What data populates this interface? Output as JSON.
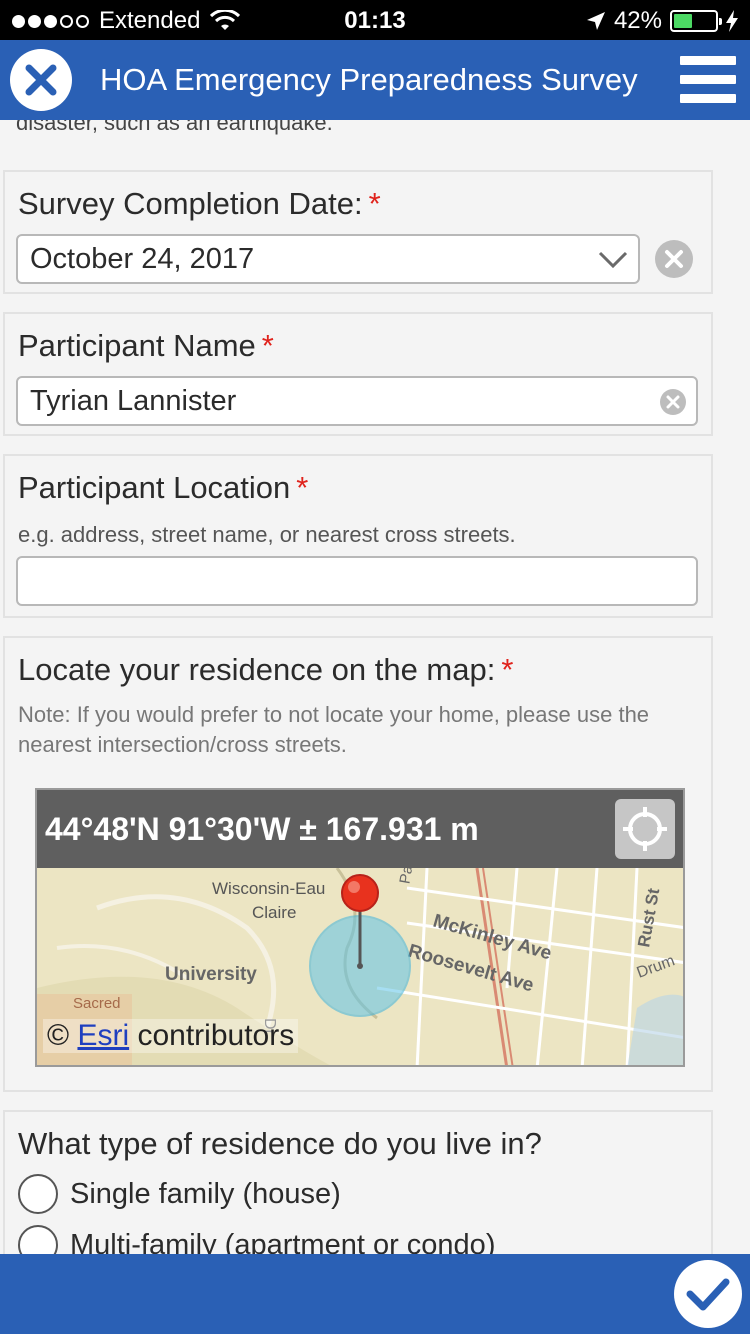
{
  "status_bar": {
    "carrier": "Extended",
    "time": "01:13",
    "battery_percent": "42%",
    "battery_level": 0.42,
    "signal_dots_filled": 3,
    "signal_dots_total": 5
  },
  "header": {
    "title": "HOA Emergency Preparedness Survey",
    "close_icon": "close-icon",
    "menu_icon": "hamburger-menu-icon"
  },
  "partial_text": "disaster, such as an earthquake.",
  "survey_date": {
    "label": "Survey Completion Date:",
    "required_mark": "*",
    "value": "October 24, 2017"
  },
  "participant_name": {
    "label": "Participant Name",
    "required_mark": "*",
    "value": "Tyrian Lannister"
  },
  "participant_location": {
    "label": "Participant Location",
    "required_mark": "*",
    "hint": "e.g. address, street name, or nearest cross streets.",
    "value": ""
  },
  "map_question": {
    "label": "Locate your residence on the map:",
    "required_mark": "*",
    "note": "Note: If you would prefer to not locate your home, please use the nearest intersection/cross streets.",
    "coordinates": "44°48'N 91°30'W ± 167.931 m",
    "attribution_prefix": "©",
    "attribution_link": "Esri",
    "attribution_suffix": "contributors",
    "map_labels": {
      "campus": "University of Wisconsin-Eau Claire",
      "campus_line1": "Wisconsin-Eau",
      "campus_line2": "Claire",
      "university": "University",
      "dr": "Dr",
      "park": "Park",
      "mckinley": "McKinley Ave",
      "roosevelt": "Roosevelt Ave",
      "rust": "Rust St",
      "drum": "Drum",
      "sacred": "Sacred"
    },
    "colors": {
      "pin": "#e8321e",
      "accuracy_circle": "#5fc4e8",
      "map_bg": "#e9e4c4"
    }
  },
  "residence_question": {
    "label": "What type of residence do you live in?",
    "options": [
      "Single family (house)",
      "Multi-family (apartment or condo)"
    ]
  },
  "footer": {
    "submit_icon": "checkmark-icon"
  },
  "colors": {
    "accent": "#2a60b5",
    "required": "#e0231c"
  }
}
